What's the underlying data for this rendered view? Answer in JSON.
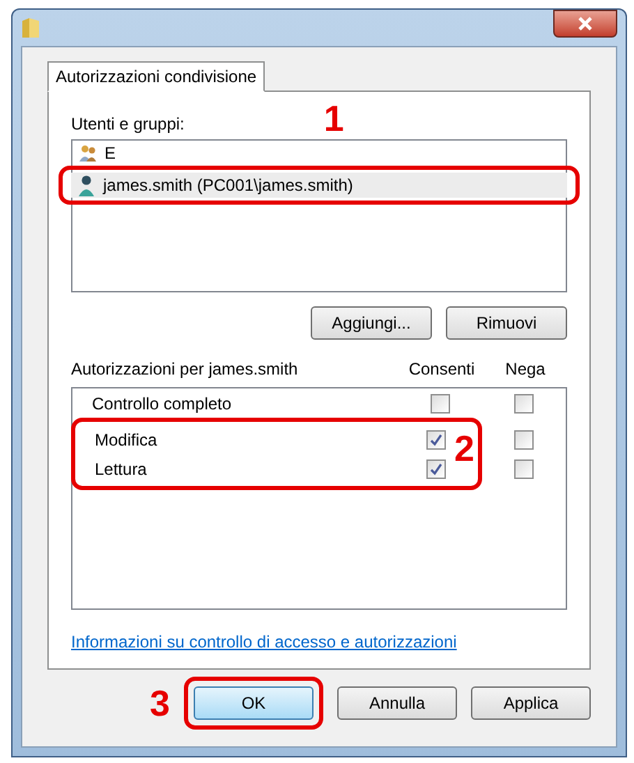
{
  "tabs": [
    {
      "label": "Autorizzazioni condivisione",
      "selected": true
    }
  ],
  "users": {
    "label": "Utenti e gruppi:",
    "callout": "1",
    "items": [
      {
        "kind": "group",
        "name": "E",
        "selected": false
      },
      {
        "kind": "user",
        "name": "james.smith (PC001\\james.smith)",
        "selected": true
      }
    ]
  },
  "user_buttons": [
    "Aggiungi...",
    "Rimuovi"
  ],
  "permissions": {
    "label": "Autorizzazioni per james.smith",
    "columns": [
      "Consenti",
      "Nega"
    ],
    "callout": "2",
    "rows": [
      {
        "name": "Controllo completo",
        "allow": false,
        "deny": false,
        "highlighted": false
      },
      {
        "name": "Modifica",
        "allow": true,
        "deny": false,
        "highlighted": true
      },
      {
        "name": "Lettura",
        "allow": true,
        "deny": false,
        "highlighted": true
      }
    ]
  },
  "link": "Informazioni su controllo di accesso e autorizzazioni",
  "footer": {
    "callout": "3",
    "buttons": [
      {
        "label": "OK",
        "default": true
      },
      {
        "label": "Annulla",
        "default": false
      },
      {
        "label": "Applica",
        "default": false
      }
    ]
  }
}
